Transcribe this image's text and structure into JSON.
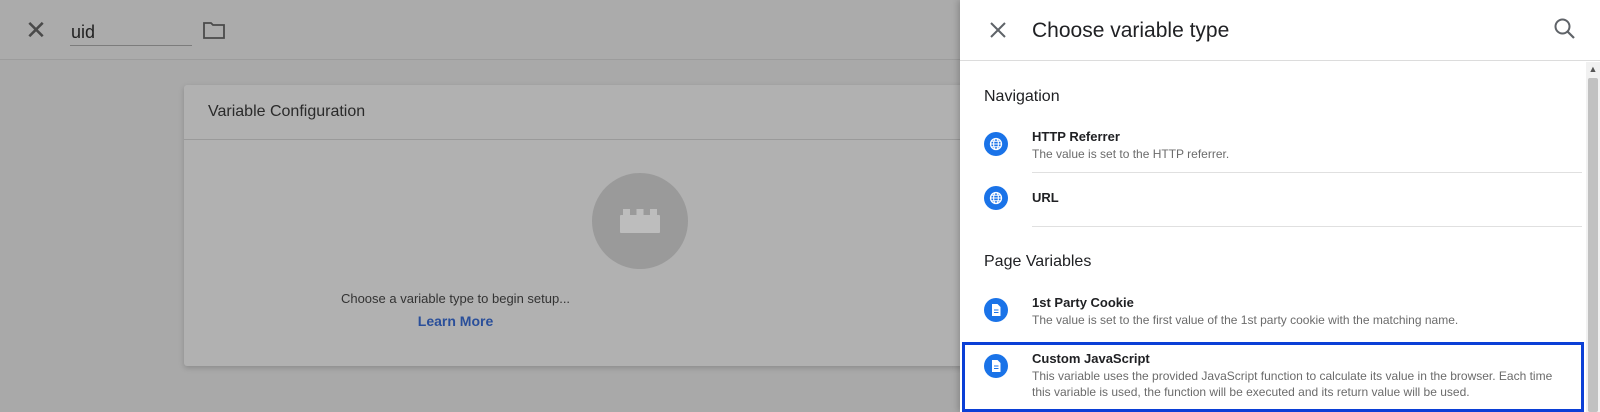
{
  "editor": {
    "variable_name": "uid",
    "card_title": "Variable Configuration",
    "empty_message": "Choose a variable type to begin setup...",
    "learn_more": "Learn More"
  },
  "panel": {
    "title": "Choose variable type",
    "sections": [
      {
        "label": "Navigation",
        "items": [
          {
            "title": "HTTP Referrer",
            "description": "The value is set to the HTTP referrer.",
            "icon": "globe-icon"
          },
          {
            "title": "URL",
            "description": "",
            "icon": "globe-icon"
          }
        ]
      },
      {
        "label": "Page Variables",
        "items": [
          {
            "title": "1st Party Cookie",
            "description": "The value is set to the first value of the 1st party cookie with the matching name.",
            "icon": "document-icon"
          },
          {
            "title": "Custom JavaScript",
            "description": "This variable uses the provided JavaScript function to calculate its value in the browser. Each time",
            "description2": "this variable is used, the function will be executed and its return value will be used.",
            "icon": "document-icon"
          }
        ]
      }
    ]
  },
  "colors": {
    "accent": "#1a73e8",
    "highlight_border": "#0b3fd6",
    "link": "#2a4f9a"
  }
}
